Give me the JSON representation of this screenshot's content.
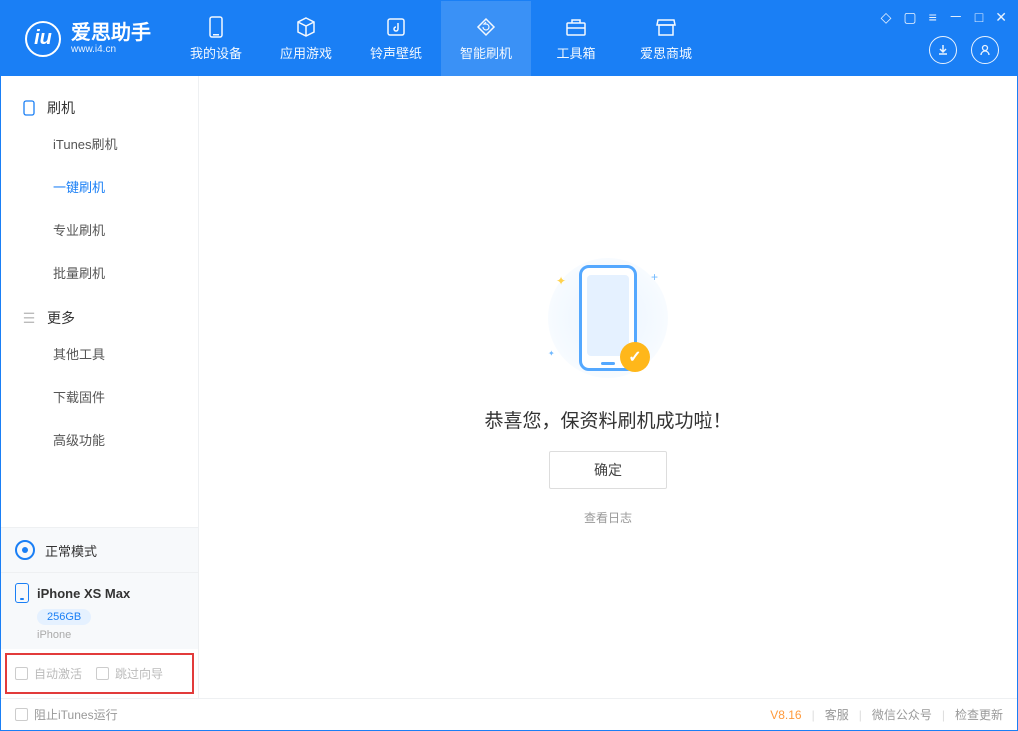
{
  "logo": {
    "title": "爱思助手",
    "url": "www.i4.cn"
  },
  "nav": {
    "items": [
      {
        "label": "我的设备"
      },
      {
        "label": "应用游戏"
      },
      {
        "label": "铃声壁纸"
      },
      {
        "label": "智能刷机"
      },
      {
        "label": "工具箱"
      },
      {
        "label": "爱思商城"
      }
    ]
  },
  "sidebar": {
    "groups": [
      {
        "title": "刷机",
        "items": [
          {
            "label": "iTunes刷机"
          },
          {
            "label": "一键刷机"
          },
          {
            "label": "专业刷机"
          },
          {
            "label": "批量刷机"
          }
        ]
      },
      {
        "title": "更多",
        "items": [
          {
            "label": "其他工具"
          },
          {
            "label": "下载固件"
          },
          {
            "label": "高级功能"
          }
        ]
      }
    ]
  },
  "device": {
    "mode": "正常模式",
    "name": "iPhone XS Max",
    "storage": "256GB",
    "type": "iPhone"
  },
  "options": {
    "auto_activate": "自动激活",
    "skip_guide": "跳过向导"
  },
  "main": {
    "message": "恭喜您，保资料刷机成功啦！",
    "confirm": "确定",
    "view_log": "查看日志"
  },
  "footer": {
    "block_itunes": "阻止iTunes运行",
    "version": "V8.16",
    "support": "客服",
    "wechat": "微信公众号",
    "check_update": "检查更新"
  }
}
